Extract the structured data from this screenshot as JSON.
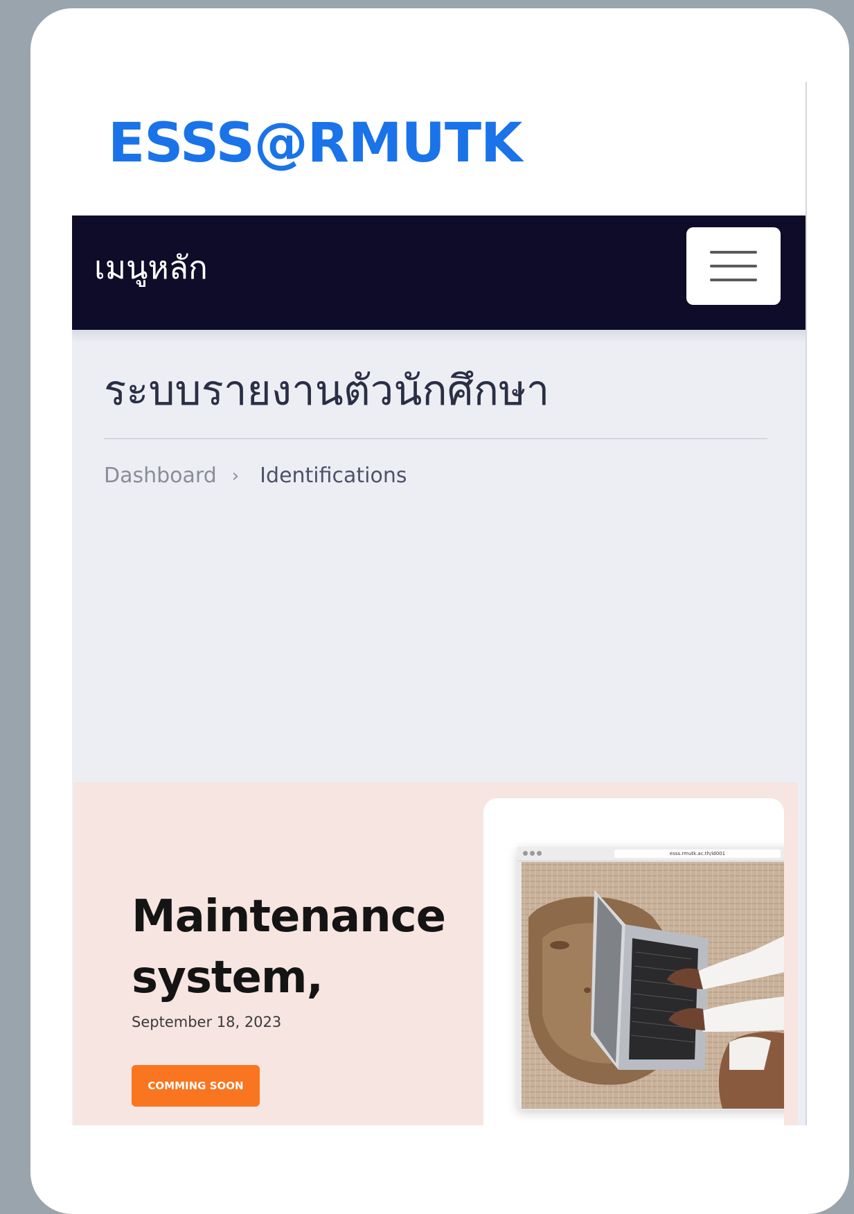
{
  "header": {
    "logo_text": "ESSS@RMUTK"
  },
  "nav": {
    "title": "เมนูหลัก",
    "toggle_icon": "hamburger-menu-icon"
  },
  "page": {
    "title": "ระบบรายงานตัวนักศึกษา"
  },
  "breadcrumb": {
    "items": [
      {
        "label": "Dashboard"
      },
      {
        "label": "Identifications"
      }
    ],
    "separator": "›"
  },
  "banner": {
    "heading_line1": "Maintenance",
    "heading_line2": "system,",
    "date": "September 18, 2023",
    "button_label": "COMMING SOON",
    "image_url_text": "esss.rmutk.ac.th/id001",
    "accent_color": "#f97520",
    "background_color": "#f6e5e0"
  },
  "colors": {
    "logo": "#1a73e8",
    "nav_background": "#0e0c28",
    "content_background": "#edeef4"
  }
}
